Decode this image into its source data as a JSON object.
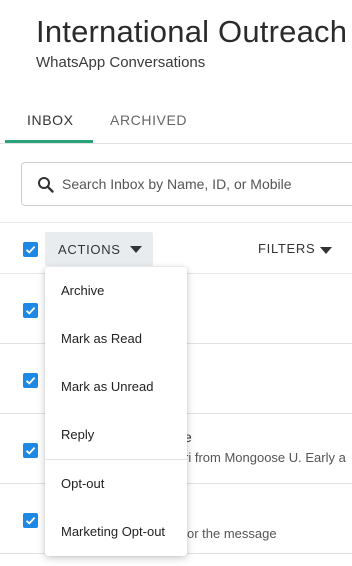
{
  "header": {
    "title": "International Outreach",
    "subtitle": "WhatsApp Conversations"
  },
  "tabs": [
    {
      "label": "INBOX",
      "active": true
    },
    {
      "label": "ARCHIVED",
      "active": false
    }
  ],
  "search": {
    "placeholder": "Search Inbox by Name, ID, or Mobile",
    "value": ""
  },
  "toolbar": {
    "actions_label": "ACTIONS",
    "filters_label": "FILTERS",
    "select_all_checked": true
  },
  "actions_menu": {
    "items": [
      "Archive",
      "Mark as Read",
      "Mark as Unread",
      "Reply",
      "Opt-out",
      "Marketing Opt-out"
    ]
  },
  "rows": [
    {
      "checked": true,
      "text_partial": "",
      "preview_partial": ""
    },
    {
      "checked": true,
      "text_partial": "",
      "preview_partial": ""
    },
    {
      "checked": true,
      "text_partial": "e",
      "preview_partial": "ri from Mongoose U. Early a"
    },
    {
      "checked": true,
      "text_partial": "",
      "preview_partial": "or the message"
    }
  ],
  "colors": {
    "accent_tab": "#2aa37a",
    "checkbox": "#1e88e5",
    "actions_bg": "#e9ecef"
  }
}
